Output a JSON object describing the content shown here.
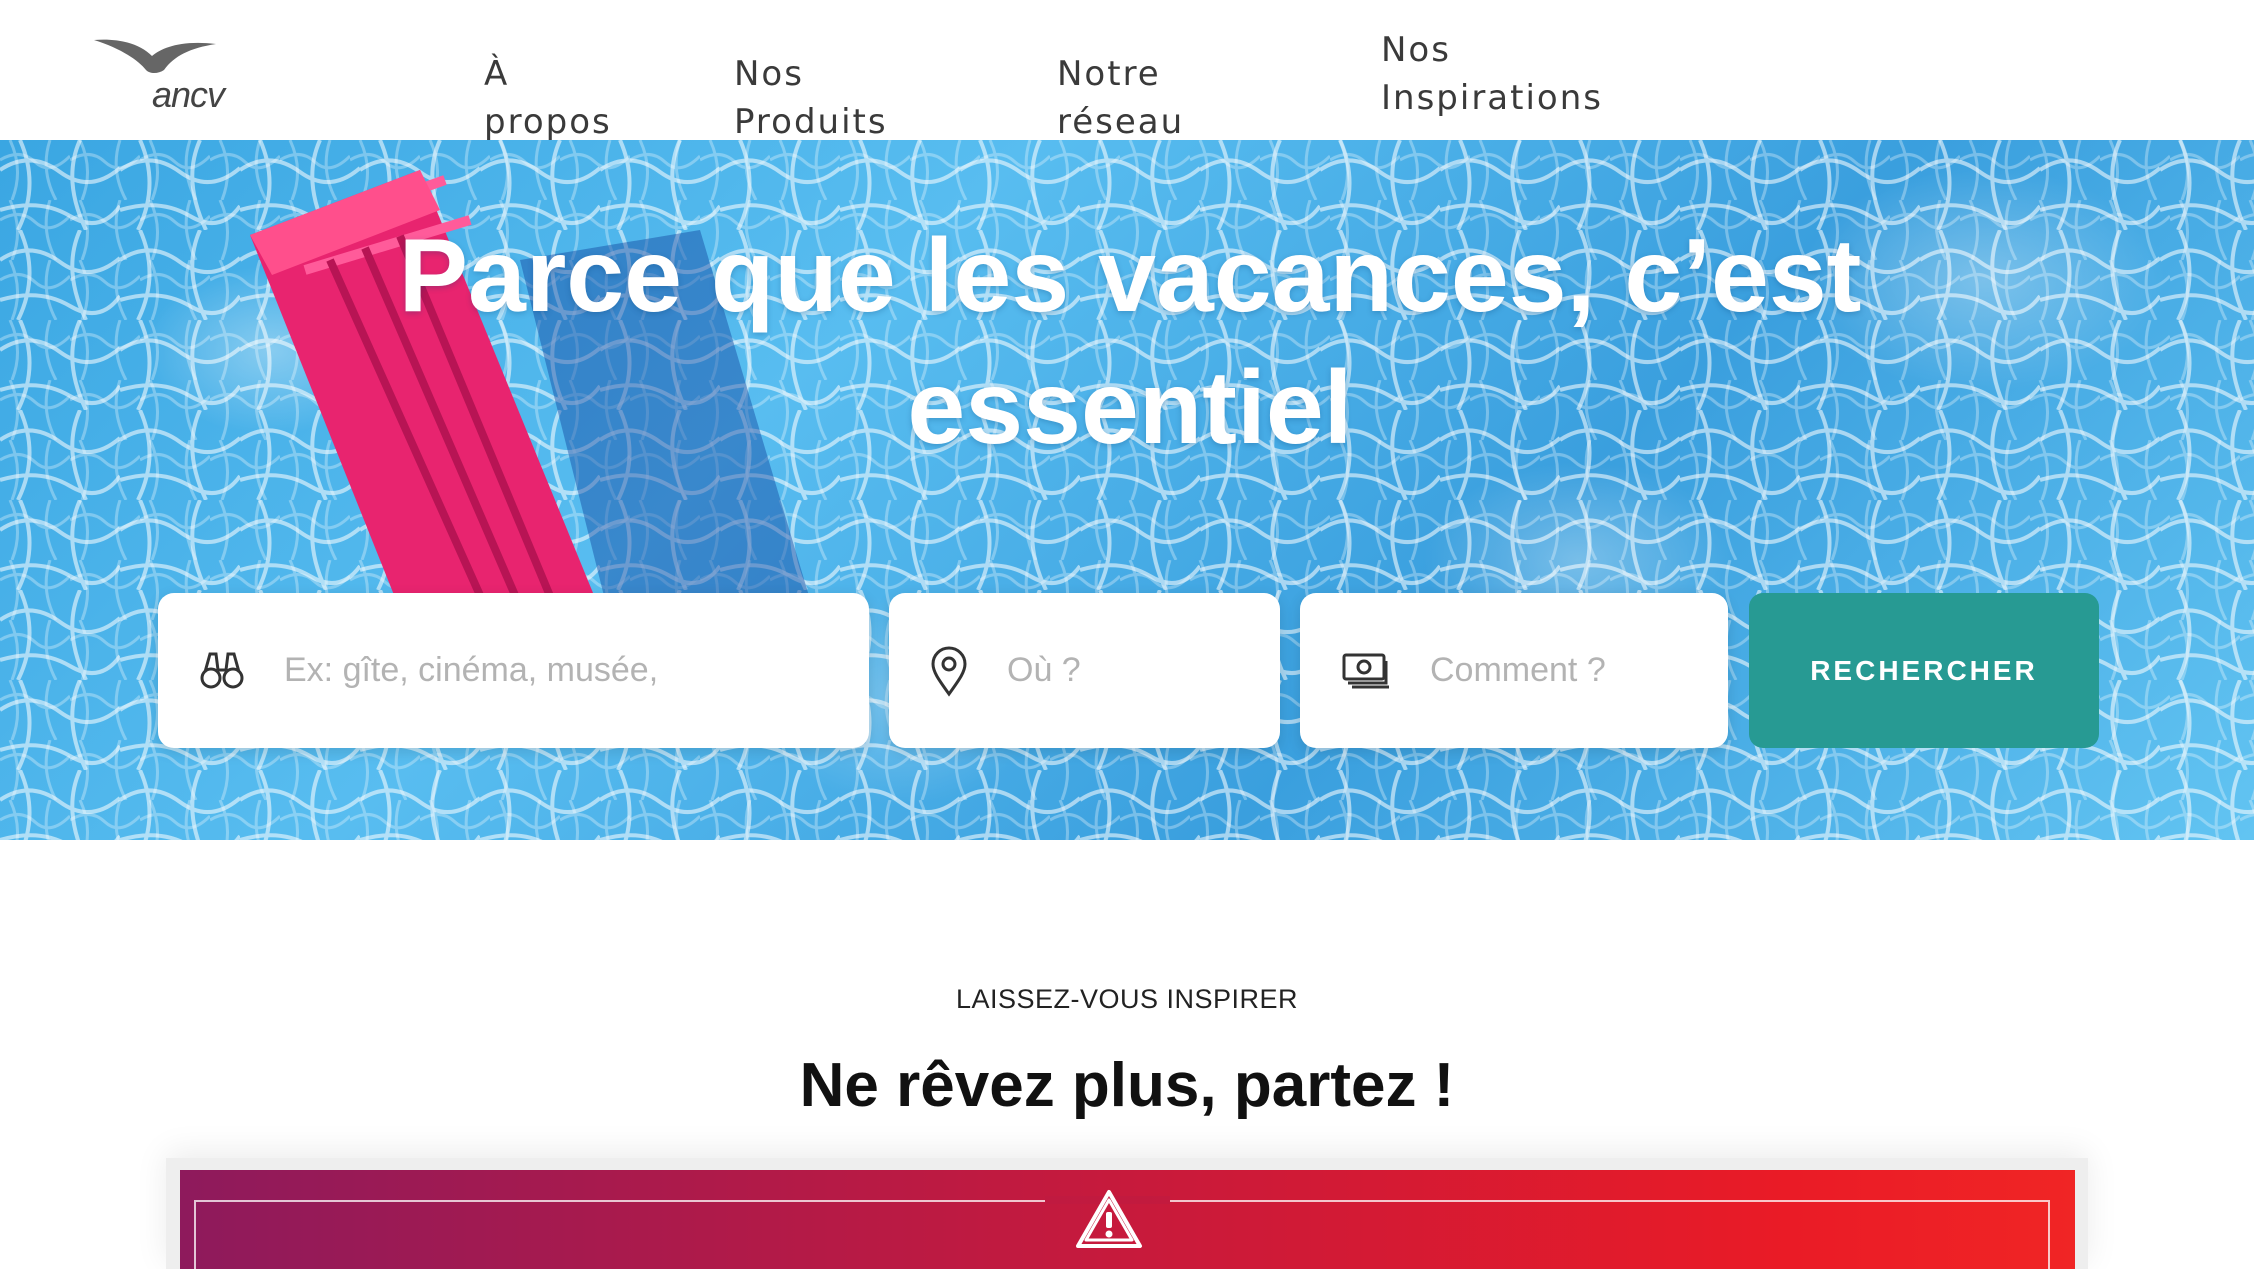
{
  "header": {
    "logo_text": "ancv",
    "nav": [
      {
        "label": "À propos"
      },
      {
        "label": "Nos Produits"
      },
      {
        "label": "Notre réseau"
      },
      {
        "label_line1": "Nos",
        "label_line2": "Inspirations"
      }
    ]
  },
  "hero": {
    "title": "Parce que les vacances, c’est essentiel",
    "search": {
      "what_placeholder": "Ex: gîte, cinéma, musée,",
      "where_placeholder": "Où ?",
      "how_placeholder": "Comment ?",
      "button_label": "RECHERCHER"
    }
  },
  "section": {
    "eyebrow": "LAISSEZ-VOUS INSPIRER",
    "title": "Ne rêvez plus, partez !"
  },
  "icons": {
    "what": "binoculars-icon",
    "where": "map-pin-icon",
    "how": "banknotes-icon",
    "alert": "warning-triangle-icon"
  },
  "colors": {
    "accent": "#279a93",
    "banner_start": "#8e1a5c",
    "banner_end": "#f02525",
    "water": "#3aa6e2",
    "float": "#e8246f"
  }
}
